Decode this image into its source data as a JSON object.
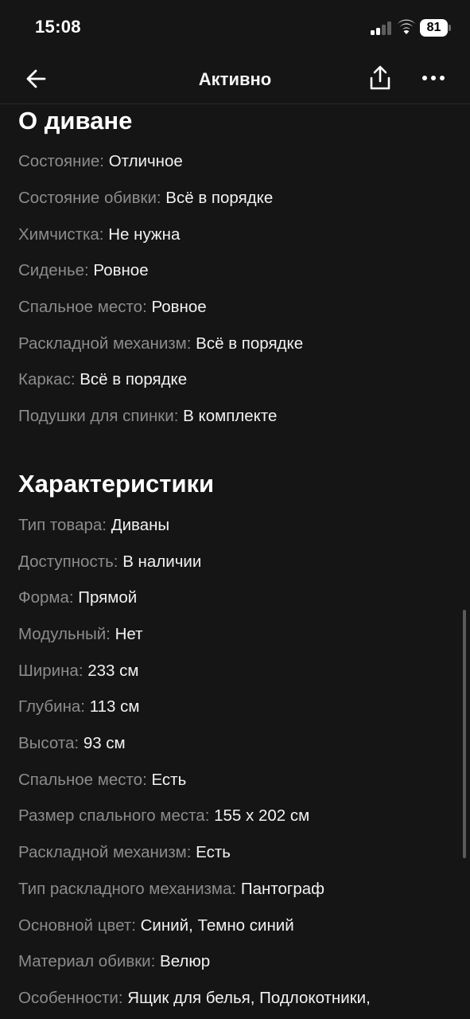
{
  "status_bar": {
    "time": "15:08",
    "battery": "81",
    "icons": [
      "signal-icon",
      "wifi-icon",
      "battery-icon"
    ]
  },
  "nav": {
    "title": "Активно",
    "icons": [
      "arrow-left-icon",
      "share-icon",
      "more-horizontal-icon"
    ]
  },
  "about": {
    "title": "О диване",
    "items": [
      {
        "key": "Состояние:",
        "value": "Отличное"
      },
      {
        "key": "Состояние обивки:",
        "value": "Всё в порядке"
      },
      {
        "key": "Химчистка:",
        "value": "Не нужна"
      },
      {
        "key": "Сиденье:",
        "value": "Ровное"
      },
      {
        "key": "Спальное место:",
        "value": "Ровное"
      },
      {
        "key": "Раскладной механизм:",
        "value": "Всё в порядке"
      },
      {
        "key": "Каркас:",
        "value": "Всё в порядке"
      },
      {
        "key": "Подушки для спинки:",
        "value": "В комплекте"
      }
    ]
  },
  "specs": {
    "title": "Характеристики",
    "items": [
      {
        "key": "Тип товара:",
        "value": "Диваны"
      },
      {
        "key": "Доступность:",
        "value": "В наличии"
      },
      {
        "key": "Форма:",
        "value": "Прямой"
      },
      {
        "key": "Модульный:",
        "value": "Нет"
      },
      {
        "key": "Ширина:",
        "value": "233 см"
      },
      {
        "key": "Глубина:",
        "value": "113 см"
      },
      {
        "key": "Высота:",
        "value": "93 см"
      },
      {
        "key": "Спальное место:",
        "value": "Есть"
      },
      {
        "key": "Размер спального места:",
        "value": "155 x 202 см"
      },
      {
        "key": "Раскладной механизм:",
        "value": "Есть"
      },
      {
        "key": "Тип раскладного механизма:",
        "value": "Пантограф"
      },
      {
        "key": "Основной цвет:",
        "value": "Синий, Темно синий"
      },
      {
        "key": "Материал обивки:",
        "value": "Велюр"
      },
      {
        "key": "Особенности:",
        "value": "Ящик для белья, Подлокотники,"
      }
    ]
  },
  "colors": {
    "background": "#151515",
    "label": "#8c8c8c",
    "value": "#f2f2f2"
  }
}
